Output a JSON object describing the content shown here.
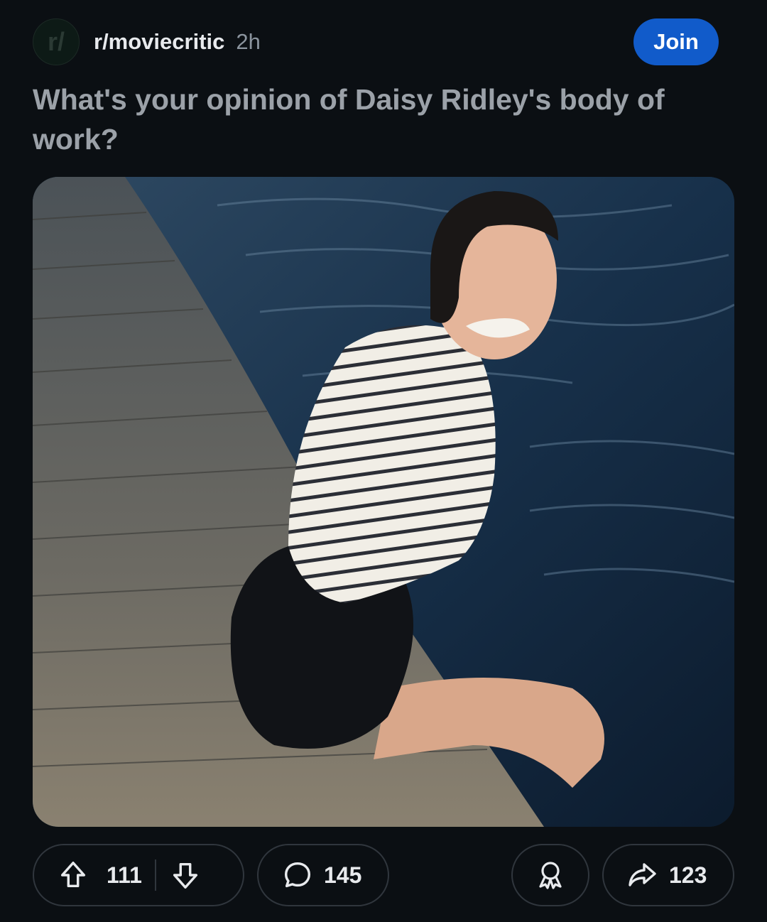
{
  "post": {
    "subreddit": "r/moviecritic",
    "avatar_text": "r/",
    "time_ago": "2h",
    "join_label": "Join",
    "title": "What's your opinion of Daisy Ridley's body of work?",
    "image_icon": "photo"
  },
  "actions": {
    "upvotes": "111",
    "comments": "145",
    "shares": "123",
    "icons": [
      "arrow-up-icon",
      "arrow-down-icon",
      "comment-bubble-icon",
      "award-icon",
      "share-arrow-icon"
    ]
  },
  "colors": {
    "background": "#0b0f13",
    "join_button": "#115bca",
    "title_text": "#9ba1a8",
    "pill_border": "#30363d"
  }
}
